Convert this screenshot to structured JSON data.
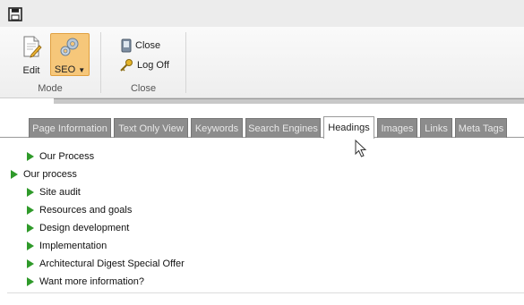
{
  "ribbon": {
    "edit_label": "Edit",
    "seo_label": "SEO",
    "mode_group_label": "Mode",
    "close_label": "Close",
    "logoff_label": "Log Off",
    "close_group_label": "Close"
  },
  "tabs": [
    {
      "label": "Page Information",
      "active": false
    },
    {
      "label": "Text Only View",
      "active": false
    },
    {
      "label": "Keywords",
      "active": false
    },
    {
      "label": "Search Engines",
      "active": false
    },
    {
      "label": "Headings",
      "active": true
    },
    {
      "label": "Images",
      "active": false
    },
    {
      "label": "Links",
      "active": false
    },
    {
      "label": "Meta Tags",
      "active": false
    }
  ],
  "headings": [
    "Our Process",
    "Our process",
    "Site audit",
    "Resources and goals",
    "Design development",
    "Implementation",
    "Architectural Digest Special Offer",
    "Want more information?"
  ],
  "colors": {
    "arrow_green": "#2f9a2a",
    "seo_button": "#f6c77a",
    "inactive_tab": "#8c8c8c"
  }
}
